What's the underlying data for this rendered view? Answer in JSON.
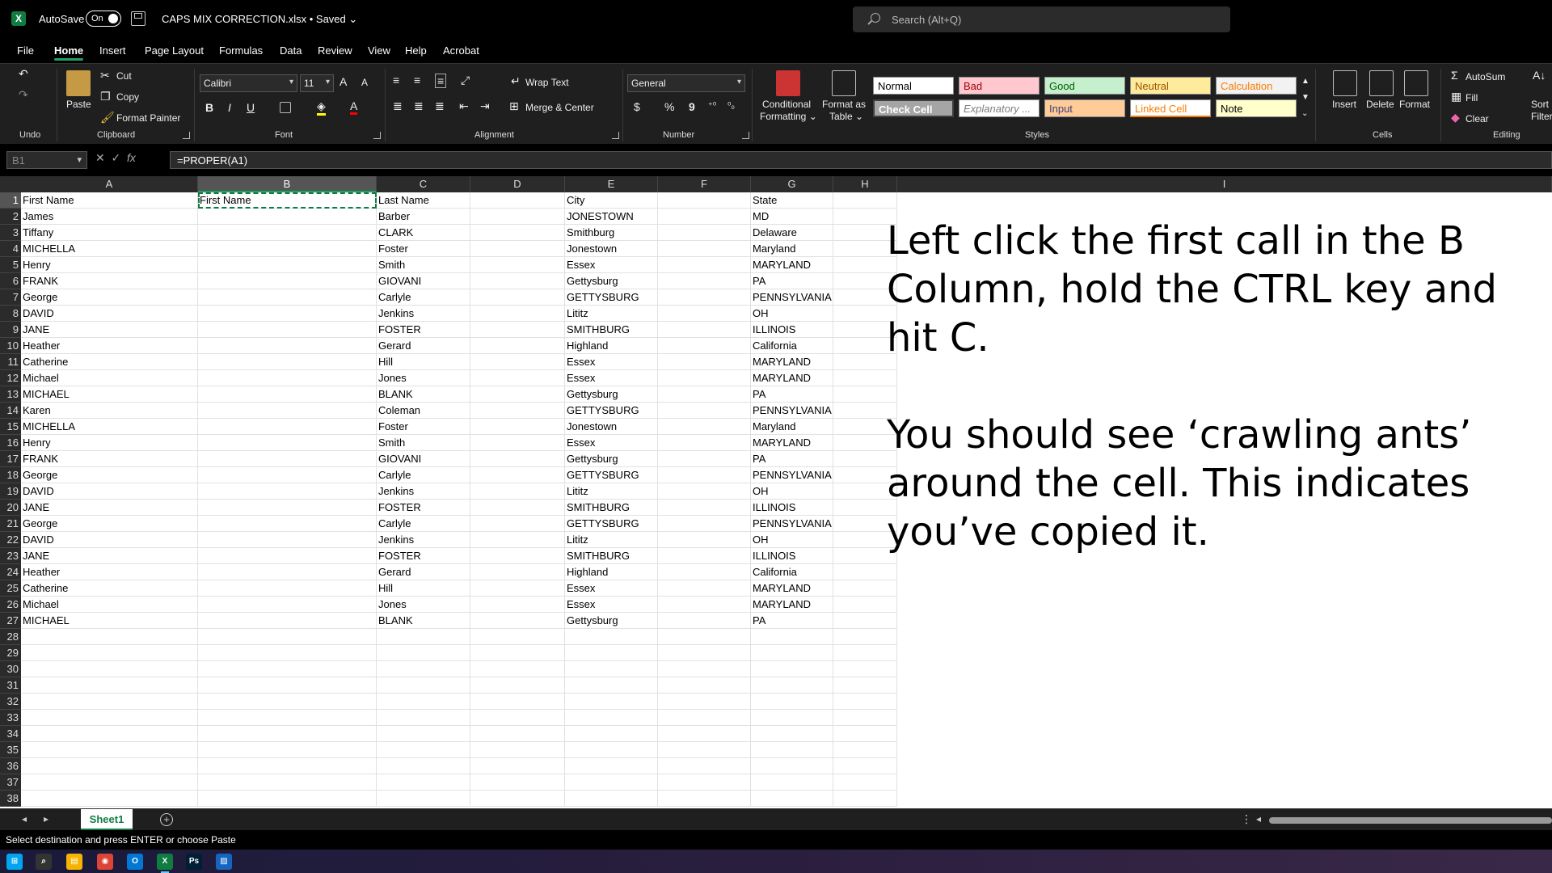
{
  "titlebar": {
    "app_logo": "X",
    "autosave_label": "AutoSave",
    "autosave_state": "On",
    "filename": "CAPS MIX CORRECTION.xlsx • Saved",
    "search_placeholder": "Search (Alt+Q)"
  },
  "menu": [
    "File",
    "Home",
    "Insert",
    "Page Layout",
    "Formulas",
    "Data",
    "Review",
    "View",
    "Help",
    "Acrobat"
  ],
  "ribbon": {
    "clipboard": {
      "paste": "Paste",
      "cut": "Cut",
      "copy": "Copy",
      "format_painter": "Format Painter",
      "label": "Clipboard"
    },
    "undo_label": "Undo",
    "font": {
      "name": "Calibri",
      "size": "11",
      "label": "Font",
      "bold": "B",
      "italic": "I",
      "underline": "U"
    },
    "alignment": {
      "wrap": "Wrap Text",
      "merge": "Merge & Center",
      "label": "Alignment"
    },
    "number": {
      "format": "General",
      "label": "Number",
      "currency": "$",
      "percent": "%",
      "comma": "9"
    },
    "styles": {
      "conditional": "Conditional",
      "conditional2": "Formatting",
      "format_table": "Format as",
      "format_table2": "Table",
      "label": "Styles",
      "cells": [
        {
          "name": "Normal",
          "bg": "#ffffff",
          "fg": "#000000"
        },
        {
          "name": "Bad",
          "bg": "#ffc7ce",
          "fg": "#9c0006"
        },
        {
          "name": "Good",
          "bg": "#c6efce",
          "fg": "#006100"
        },
        {
          "name": "Neutral",
          "bg": "#ffeb9c",
          "fg": "#9c5700"
        },
        {
          "name": "Calculation",
          "bg": "#f2f2f2",
          "fg": "#fa7d00"
        },
        {
          "name": "Check Cell",
          "bg": "#a5a5a5",
          "fg": "#ffffff"
        },
        {
          "name": "Explanatory ...",
          "bg": "#ffffff",
          "fg": "#7f7f7f"
        },
        {
          "name": "Input",
          "bg": "#ffcc99",
          "fg": "#3f3f76"
        },
        {
          "name": "Linked Cell",
          "bg": "#ffffff",
          "fg": "#fa7d00"
        },
        {
          "name": "Note",
          "bg": "#ffffcc",
          "fg": "#000000"
        }
      ]
    },
    "cells": {
      "insert": "Insert",
      "delete": "Delete",
      "format": "Format",
      "label": "Cells"
    },
    "editing": {
      "autosum": "AutoSum",
      "fill": "Fill",
      "clear": "Clear",
      "sort": "Sort",
      "filter": "Filter",
      "label": "Editing"
    }
  },
  "formula_bar": {
    "name_box": "B1",
    "fx": "fx",
    "formula": "=PROPER(A1)"
  },
  "columns": [
    "A",
    "B",
    "C",
    "D",
    "E",
    "F",
    "G",
    "H",
    "I"
  ],
  "row_count": 38,
  "rows": [
    [
      "First Name",
      "First Name",
      "Last Name",
      "",
      "City",
      "",
      "State"
    ],
    [
      "James",
      "",
      "Barber",
      "",
      "JONESTOWN",
      "",
      "MD"
    ],
    [
      "Tiffany",
      "",
      "CLARK",
      "",
      "Smithburg",
      "",
      "Delaware"
    ],
    [
      "MICHELLA",
      "",
      "Foster",
      "",
      "Jonestown",
      "",
      "Maryland"
    ],
    [
      "Henry",
      "",
      "Smith",
      "",
      "Essex",
      "",
      "MARYLAND"
    ],
    [
      "FRANK",
      "",
      "GIOVANI",
      "",
      "Gettysburg",
      "",
      "PA"
    ],
    [
      "George",
      "",
      "Carlyle",
      "",
      "GETTYSBURG",
      "",
      "PENNSYLVANIA"
    ],
    [
      "DAVID",
      "",
      "Jenkins",
      "",
      "Lititz",
      "",
      "OH"
    ],
    [
      "JANE",
      "",
      "FOSTER",
      "",
      "SMITHBURG",
      "",
      "ILLINOIS"
    ],
    [
      "Heather",
      "",
      "Gerard",
      "",
      "Highland",
      "",
      "California"
    ],
    [
      "Catherine",
      "",
      "Hill",
      "",
      "Essex",
      "",
      "MARYLAND"
    ],
    [
      "Michael",
      "",
      "Jones",
      "",
      "Essex",
      "",
      "MARYLAND"
    ],
    [
      "MICHAEL",
      "",
      "BLANK",
      "",
      "Gettysburg",
      "",
      "PA"
    ],
    [
      "Karen",
      "",
      "Coleman",
      "",
      "GETTYSBURG",
      "",
      "PENNSYLVANIA"
    ],
    [
      "MICHELLA",
      "",
      "Foster",
      "",
      "Jonestown",
      "",
      "Maryland"
    ],
    [
      "Henry",
      "",
      "Smith",
      "",
      "Essex",
      "",
      "MARYLAND"
    ],
    [
      "FRANK",
      "",
      "GIOVANI",
      "",
      "Gettysburg",
      "",
      "PA"
    ],
    [
      "George",
      "",
      "Carlyle",
      "",
      "GETTYSBURG",
      "",
      "PENNSYLVANIA"
    ],
    [
      "DAVID",
      "",
      "Jenkins",
      "",
      "Lititz",
      "",
      "OH"
    ],
    [
      "JANE",
      "",
      "FOSTER",
      "",
      "SMITHBURG",
      "",
      "ILLINOIS"
    ],
    [
      "George",
      "",
      "Carlyle",
      "",
      "GETTYSBURG",
      "",
      "PENNSYLVANIA"
    ],
    [
      "DAVID",
      "",
      "Jenkins",
      "",
      "Lititz",
      "",
      "OH"
    ],
    [
      "JANE",
      "",
      "FOSTER",
      "",
      "SMITHBURG",
      "",
      "ILLINOIS"
    ],
    [
      "Heather",
      "",
      "Gerard",
      "",
      "Highland",
      "",
      "California"
    ],
    [
      "Catherine",
      "",
      "Hill",
      "",
      "Essex",
      "",
      "MARYLAND"
    ],
    [
      "Michael",
      "",
      "Jones",
      "",
      "Essex",
      "",
      "MARYLAND"
    ],
    [
      "MICHAEL",
      "",
      "BLANK",
      "",
      "Gettysburg",
      "",
      "PA"
    ]
  ],
  "overlay": {
    "para1": "Left click the first call in the B Column, hold the CTRL key and hit C.",
    "para2": "You should see ‘crawling ants’ around the cell. This indicates you’ve copied it."
  },
  "sheet_tabs": {
    "active": "Sheet1",
    "add": "+"
  },
  "status": {
    "text": "Select destination and press ENTER or choose Paste"
  },
  "taskbar": [
    {
      "name": "windows-start-icon",
      "glyph": "⊞",
      "color": "#00a4ef"
    },
    {
      "name": "search-icon",
      "glyph": "⌕",
      "color": "#333"
    },
    {
      "name": "file-explorer-icon",
      "glyph": "▤",
      "color": "#f4b400"
    },
    {
      "name": "chrome-icon",
      "glyph": "◉",
      "color": "#db4437"
    },
    {
      "name": "outlook-icon",
      "glyph": "O",
      "color": "#0078d4"
    },
    {
      "name": "excel-icon",
      "glyph": "X",
      "color": "#107c41"
    },
    {
      "name": "photoshop-icon",
      "glyph": "Ps",
      "color": "#001e36"
    },
    {
      "name": "paint-icon",
      "glyph": "▨",
      "color": "#1565c0"
    }
  ]
}
